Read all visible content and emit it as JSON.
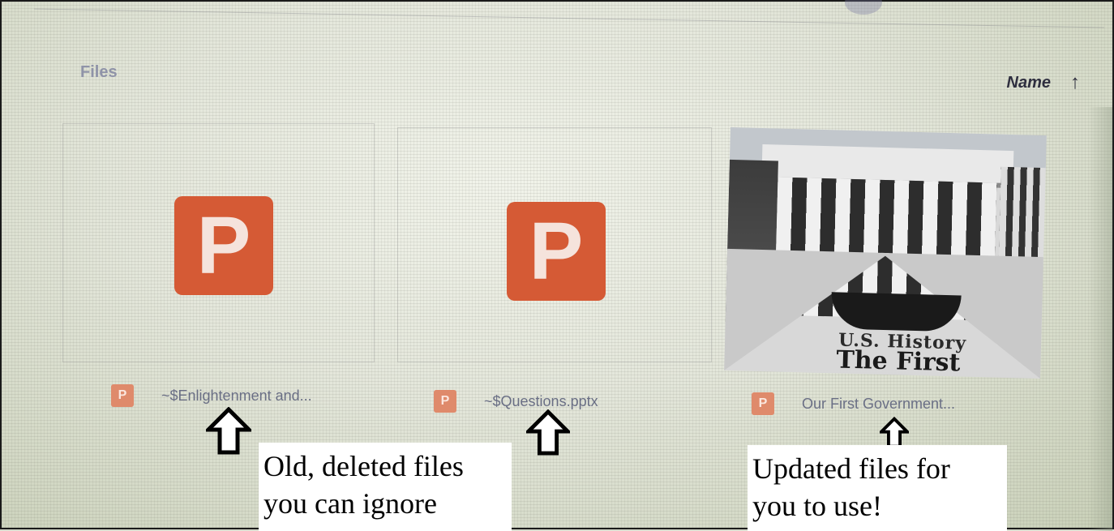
{
  "header": {
    "title": "Files",
    "sort_label": "Name",
    "sort_icon": "arrow-up-icon"
  },
  "files": [
    {
      "name": "~$Enlightenment and...",
      "icon": "powerpoint-icon",
      "icon_letter": "P"
    },
    {
      "name": "~$Questions.pptx",
      "icon": "powerpoint-icon",
      "icon_letter": "P"
    },
    {
      "name": "Our First Government...",
      "icon": "powerpoint-icon",
      "icon_letter": "P",
      "thumbnail_text": [
        "U.S. History",
        "The First"
      ]
    }
  ],
  "annotations": {
    "left": [
      "Old, deleted files",
      "you can ignore"
    ],
    "right": [
      "Updated files for",
      "you to use!"
    ]
  },
  "colors": {
    "powerpoint": "#d55a35",
    "powerpoint_small": "#df8a6b",
    "file_name": "#6a6f85"
  }
}
